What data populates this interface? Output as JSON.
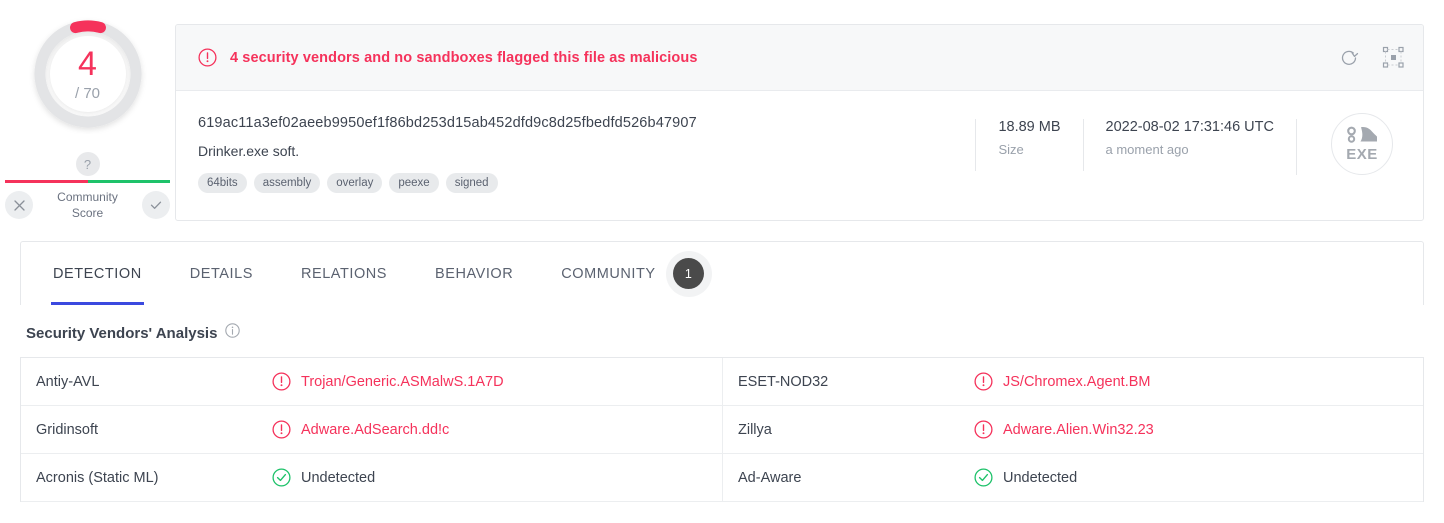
{
  "score": {
    "detections": "4",
    "total": "/ 70",
    "ratio_percent": 5.7,
    "accent_color": "#f5325b"
  },
  "community": {
    "help_icon": "question-mark-icon",
    "label_line1": "Community",
    "label_line2": "Score",
    "downvote_icon": "x-icon",
    "upvote_icon": "check-icon",
    "bar_negative_color": "#f5325b",
    "bar_positive_color": "#1ec26a"
  },
  "banner": {
    "icon": "alert-circle-icon",
    "text": "4 security vendors and no sandboxes flagged this file as malicious",
    "color": "#f5325b",
    "reanalyze_icon": "refresh-icon",
    "fullscreen_icon": "expand-icon"
  },
  "file": {
    "hash": "619ac11a3ef02aeeb9950ef1f86bd253d15ab452dfd9c8d25fbedfd526b47907",
    "name": "Drinker.exe soft.",
    "tags": [
      "64bits",
      "assembly",
      "overlay",
      "peexe",
      "signed"
    ],
    "size_value": "18.89 MB",
    "size_label": "Size",
    "date_value": "2022-08-02 17:31:46 UTC",
    "date_label": "a moment ago",
    "filetype_icon": "exe-gear-icon",
    "filetype_label": "EXE"
  },
  "tabs": [
    {
      "label": "DETECTION",
      "active": true
    },
    {
      "label": "DETAILS",
      "active": false
    },
    {
      "label": "RELATIONS",
      "active": false
    },
    {
      "label": "BEHAVIOR",
      "active": false
    },
    {
      "label": "COMMUNITY",
      "active": false,
      "badge": "1"
    }
  ],
  "vendors_section": {
    "title": "Security Vendors' Analysis",
    "info_icon": "info-circle-icon"
  },
  "vendor_rows": [
    {
      "left": {
        "name": "Antiy-AVL",
        "status": "malicious",
        "icon": "alert-circle-icon",
        "result": "Trojan/Generic.ASMalwS.1A7D"
      },
      "right": {
        "name": "ESET-NOD32",
        "status": "malicious",
        "icon": "alert-circle-icon",
        "result": "JS/Chromex.Agent.BM"
      }
    },
    {
      "left": {
        "name": "Gridinsoft",
        "status": "malicious",
        "icon": "alert-circle-icon",
        "result": "Adware.AdSearch.dd!c"
      },
      "right": {
        "name": "Zillya",
        "status": "malicious",
        "icon": "alert-circle-icon",
        "result": "Adware.Alien.Win32.23"
      }
    },
    {
      "left": {
        "name": "Acronis (Static ML)",
        "status": "clean",
        "icon": "check-circle-icon",
        "result": "Undetected"
      },
      "right": {
        "name": "Ad-Aware",
        "status": "clean",
        "icon": "check-circle-icon",
        "result": "Undetected"
      }
    }
  ]
}
